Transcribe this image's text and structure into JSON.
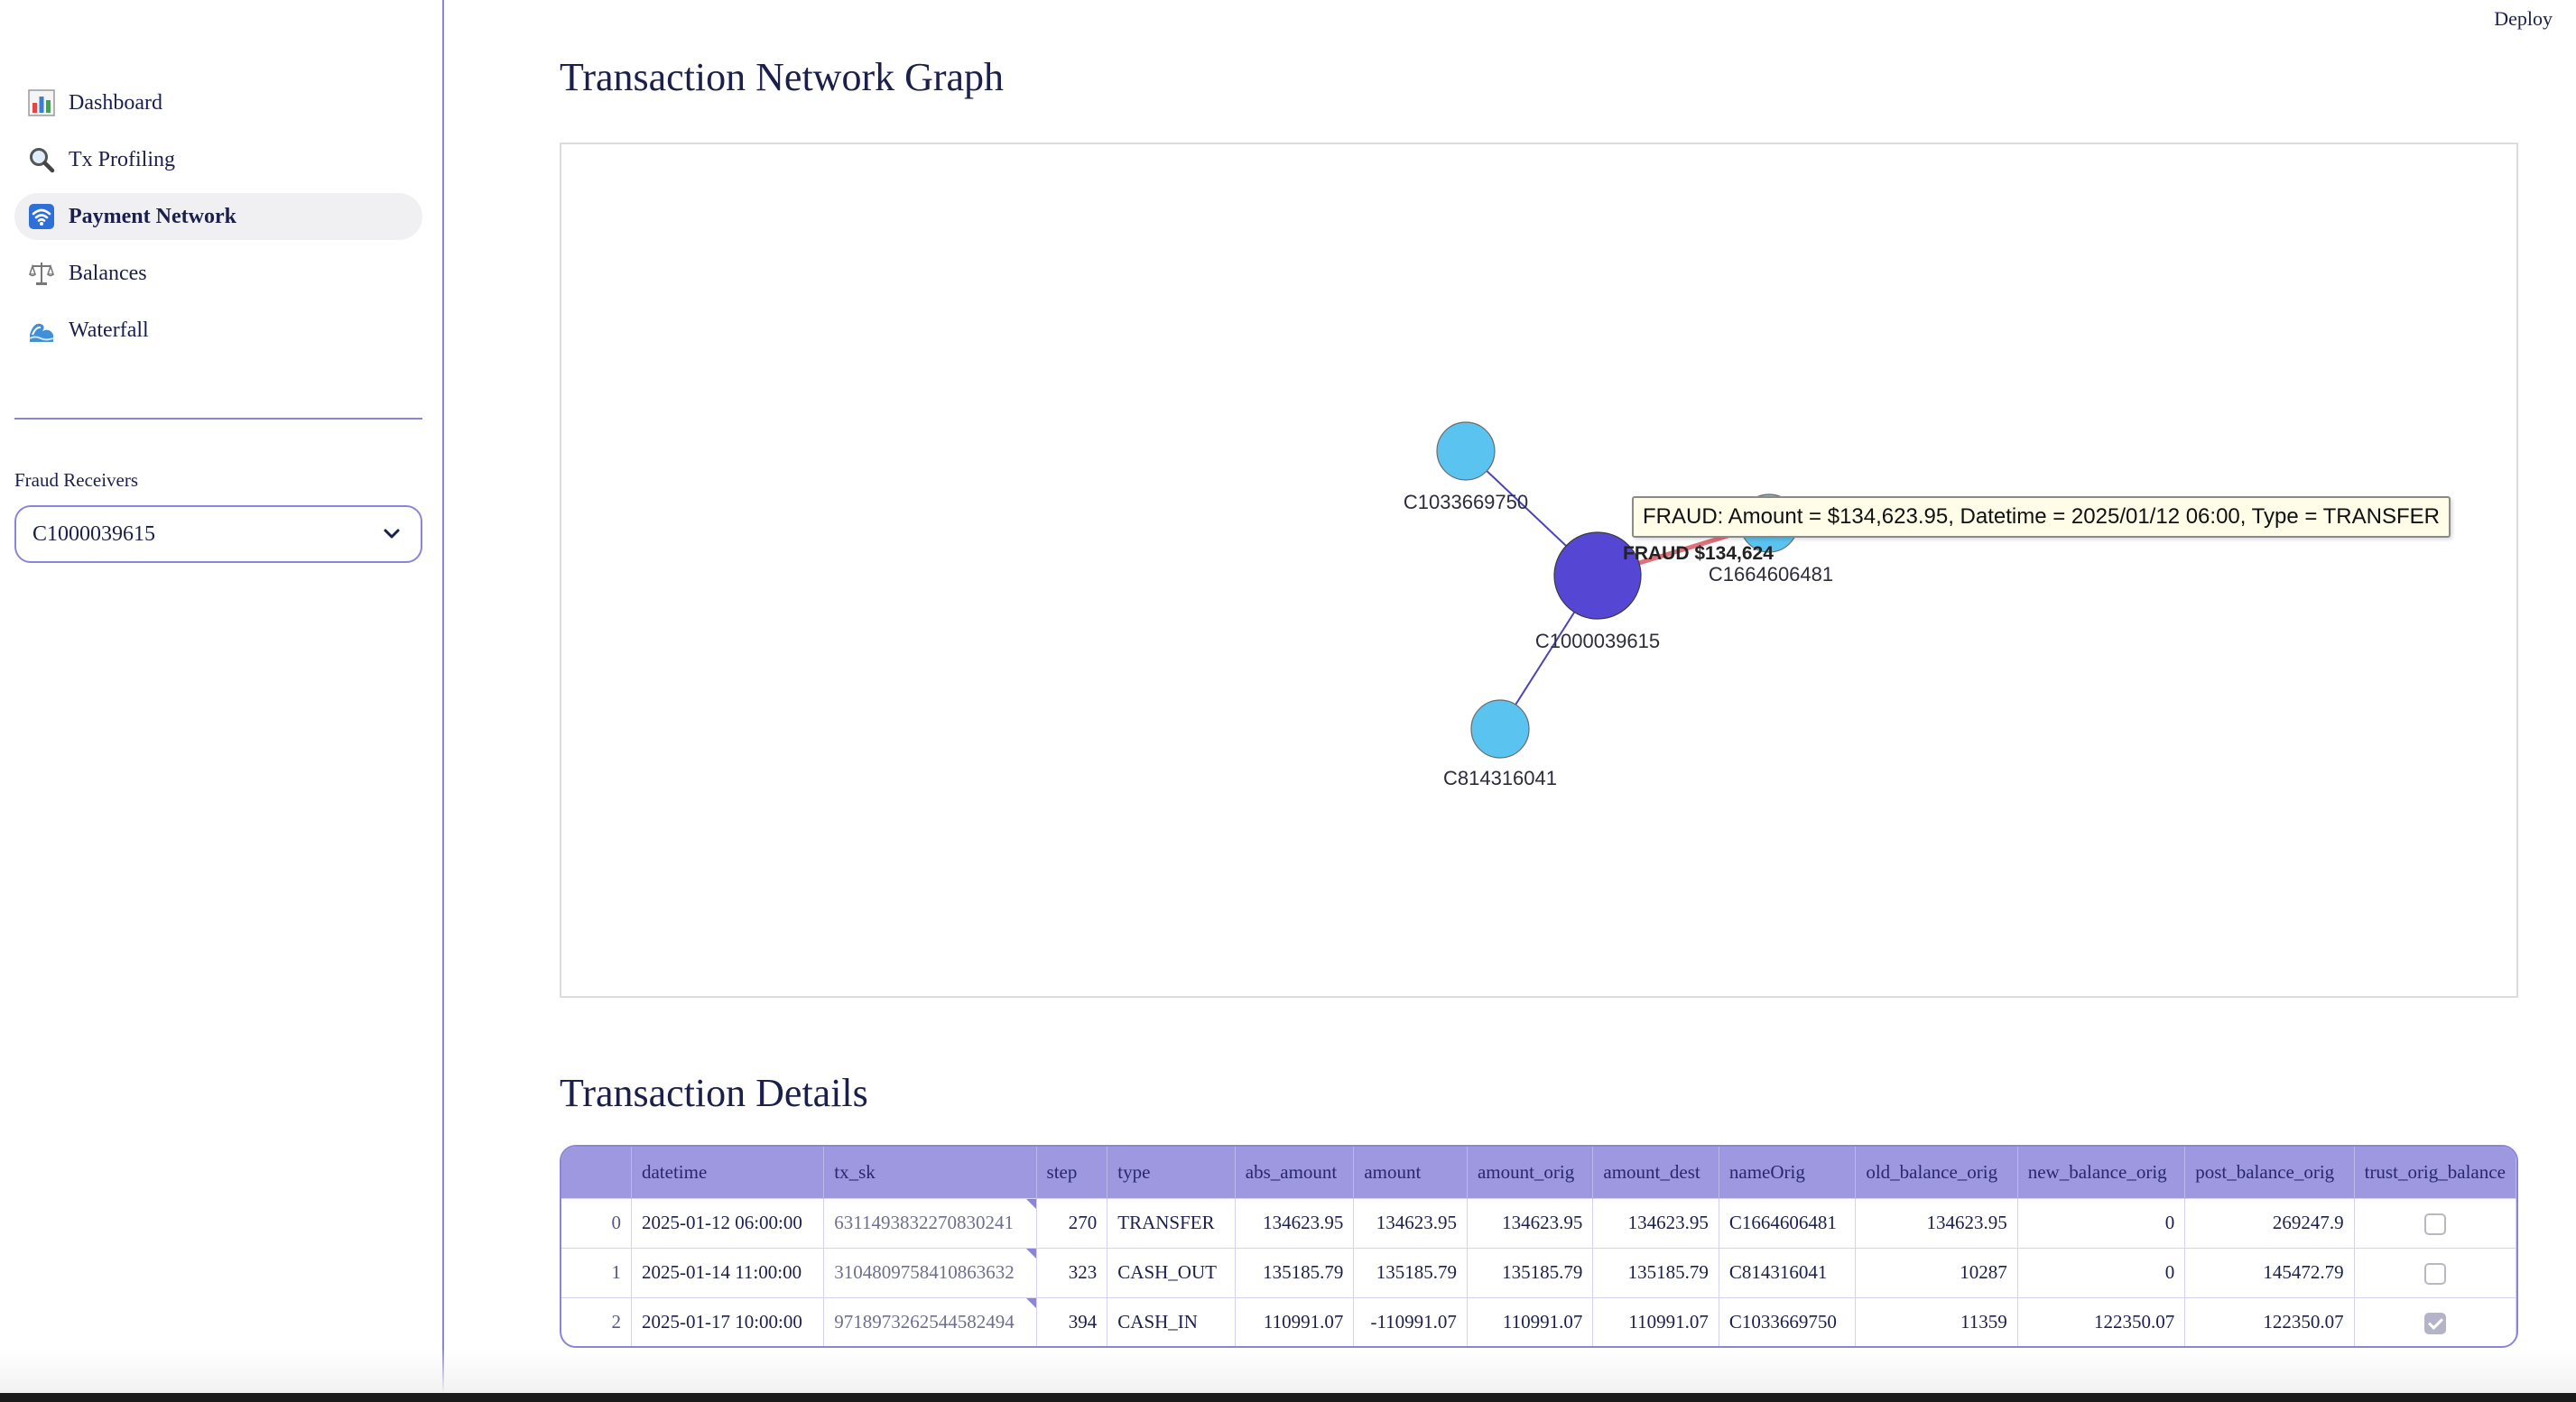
{
  "header": {
    "deploy_label": "Deploy"
  },
  "sidebar": {
    "nav": [
      {
        "label": "Dashboard",
        "icon": "bar-chart-icon"
      },
      {
        "label": "Tx Profiling",
        "icon": "magnifier-icon"
      },
      {
        "label": "Payment Network",
        "icon": "wifi-icon",
        "active": true
      },
      {
        "label": "Balances",
        "icon": "scales-icon"
      },
      {
        "label": "Waterfall",
        "icon": "wave-icon"
      }
    ],
    "filter_label": "Fraud Receivers",
    "filter_value": "C1000039615"
  },
  "graph": {
    "title": "Transaction Network Graph",
    "nodes": [
      {
        "id": "C1000039615",
        "label": "C1000039615",
        "role": "center",
        "color": "#5546d4"
      },
      {
        "id": "C1033669750",
        "label": "C1033669750",
        "role": "peer",
        "color": "#5bc3f0"
      },
      {
        "id": "C1664606481",
        "label": "C1664606481",
        "role": "peer",
        "color": "#5bc3f0"
      },
      {
        "id": "C814316041",
        "label": "C814316041",
        "role": "peer",
        "color": "#5bc3f0"
      }
    ],
    "edges": [
      {
        "from": "C1033669750",
        "to": "C1000039615",
        "color": "#4a44b8",
        "fraud": false
      },
      {
        "from": "C1664606481",
        "to": "C1000039615",
        "color": "#e0707a",
        "fraud": true,
        "label": "FRAUD $134,624"
      },
      {
        "from": "C814316041",
        "to": "C1000039615",
        "color": "#4a44b8",
        "fraud": false
      }
    ],
    "tooltip": "FRAUD: Amount = $134,623.95, Datetime = 2025/01/12 06:00, Type = TRANSFER"
  },
  "table": {
    "title": "Transaction Details",
    "columns": [
      "",
      "datetime",
      "tx_sk",
      "step",
      "type",
      "abs_amount",
      "amount",
      "amount_orig",
      "amount_dest",
      "nameOrig",
      "old_balance_orig",
      "new_balance_orig",
      "post_balance_orig",
      "trust_orig_balance"
    ],
    "rows": [
      [
        "0",
        "2025-01-12 06:00:00",
        "6311493832270830241",
        "270",
        "TRANSFER",
        "134623.95",
        "134623.95",
        "134623.95",
        "134623.95",
        "C1664606481",
        "134623.95",
        "0",
        "269247.9",
        false
      ],
      [
        "1",
        "2025-01-14 11:00:00",
        "3104809758410863632",
        "323",
        "CASH_OUT",
        "135185.79",
        "135185.79",
        "135185.79",
        "135185.79",
        "C814316041",
        "10287",
        "0",
        "145472.79",
        false
      ],
      [
        "2",
        "2025-01-17 10:00:00",
        "9718973262544582494",
        "394",
        "CASH_IN",
        "110991.07",
        "-110991.07",
        "110991.07",
        "110991.07",
        "C1033669750",
        "11359",
        "122350.07",
        "122350.07",
        true
      ]
    ]
  }
}
